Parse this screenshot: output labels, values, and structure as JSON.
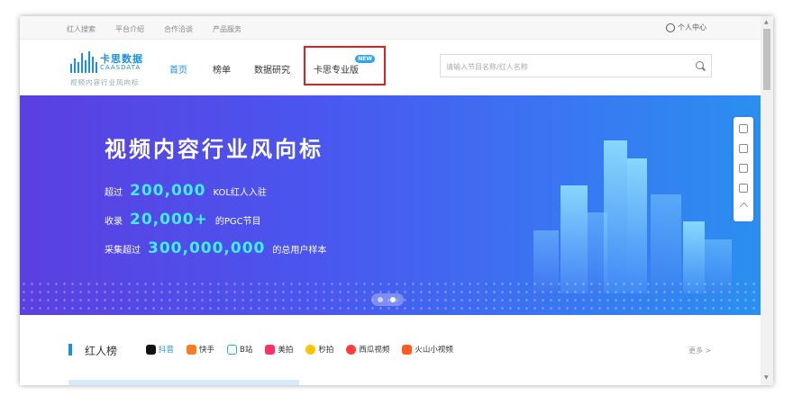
{
  "topbar": {
    "links": [
      "红人搜索",
      "平台介绍",
      "合作洽谈",
      "产品服务"
    ],
    "user_center": "个人中心"
  },
  "logo": {
    "cn": "卡思数据",
    "en": "CAASDATA",
    "tagline": "视频内容行业风向标"
  },
  "nav": {
    "items": [
      "首页",
      "榜单",
      "数据研究",
      "卡思专业版"
    ],
    "new_badge": "NEW"
  },
  "search": {
    "placeholder": "请输入节目名称/红人名称"
  },
  "banner": {
    "title": "视频内容行业风向标",
    "line1_pre": "超过",
    "line1_num": "200,000",
    "line1_post": "KOL红人入驻",
    "line2_pre": "收录",
    "line2_num": "20,000+",
    "line2_post": "的PGC节目",
    "line3_pre": "采集超过",
    "line3_num": "300,000,000",
    "line3_post": "的总用户样本",
    "carousel_active_index": 2,
    "carousel_count": 2
  },
  "ranking": {
    "title": "红人榜",
    "tabs": [
      {
        "label": "抖音",
        "color": "#111111"
      },
      {
        "label": "快手",
        "color": "#ff7a1a"
      },
      {
        "label": "B站",
        "color": "#23ade5"
      },
      {
        "label": "美拍",
        "color": "#ff2e63"
      },
      {
        "label": "秒拍",
        "color": "#ffc400"
      },
      {
        "label": "西瓜视频",
        "color": "#ff3b3b"
      },
      {
        "label": "火山小视频",
        "color": "#ff5a1f"
      }
    ],
    "more": "更多 >"
  },
  "colors": {
    "accent": "#1d8fe0",
    "highlight_border": "#e02020",
    "banner_num": "#3ff0ff"
  }
}
